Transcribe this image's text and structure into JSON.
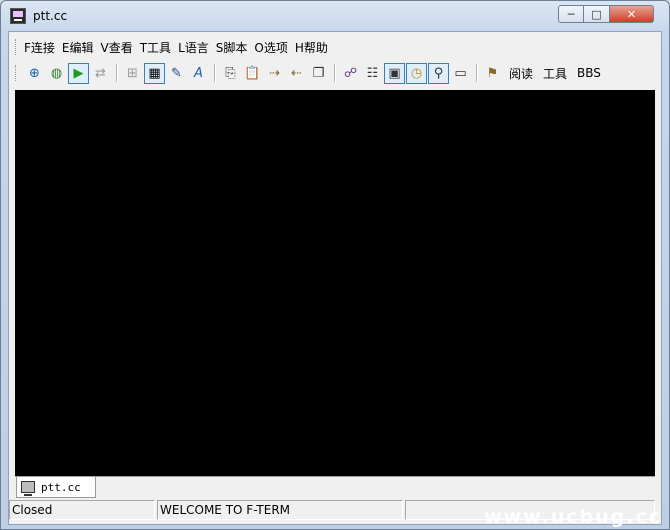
{
  "window": {
    "title": "ptt.cc",
    "controls": {
      "minimize": "─",
      "maximize": "□",
      "close": "✕"
    }
  },
  "menu": [
    {
      "label": "F连接"
    },
    {
      "label": "E编辑"
    },
    {
      "label": "V查看"
    },
    {
      "label": "T工具"
    },
    {
      "label": "L语言"
    },
    {
      "label": "S脚本"
    },
    {
      "label": "O选项"
    },
    {
      "label": "H帮助"
    }
  ],
  "toolbar": {
    "icons": {
      "quick_connect": "⊕",
      "connect": "◍",
      "run": "▶",
      "disconnect": "⇄",
      "copy": "⎘",
      "paste": "📋",
      "select_all": "▦",
      "edit": "✎",
      "font": "A",
      "send": "⇢",
      "receive": "⇠",
      "document": "❐",
      "users": "☍",
      "list": "☷",
      "image": "▣",
      "clock": "◷",
      "link": "⚲",
      "monitor": "▭",
      "flag": "⚑",
      "unknown": "⊞"
    },
    "text_buttons": {
      "read": "阅读",
      "tools": "工具",
      "bbs": "BBS"
    }
  },
  "tab": {
    "label": "ptt.cc"
  },
  "status": {
    "connection": "Closed",
    "message": "WELCOME TO F-TERM",
    "extra": ""
  },
  "watermark": "www.ucbug.cc",
  "colors": {
    "terminal_bg": "#000000",
    "accent": "#3c7fb1"
  }
}
